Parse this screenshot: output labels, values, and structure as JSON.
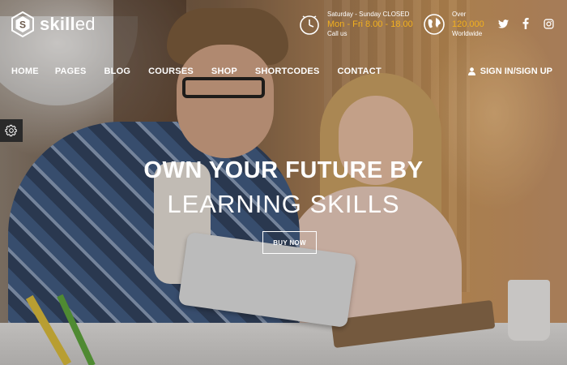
{
  "brand": {
    "name_bold": "skill",
    "name_light": "ed",
    "logo_letter": "S"
  },
  "header": {
    "schedule": {
      "days": "Saturday - Sunday CLOSED",
      "hours": "Mon - Fri 8.00 - 18.00",
      "sub": "Call us"
    },
    "students": {
      "label": "Over",
      "count": "120.000",
      "sub": "Worldwide"
    },
    "social": [
      "twitter-icon",
      "facebook-icon",
      "instagram-icon"
    ]
  },
  "nav": {
    "items": [
      "HOME",
      "PAGES",
      "BLOG",
      "COURSES",
      "SHOP",
      "SHORTCODES",
      "CONTACT"
    ],
    "signin": "SIGN IN/SIGN UP"
  },
  "hero": {
    "title": "OWN YOUR FUTURE BY",
    "subtitle": "LEARNING SKILLS",
    "cta": "BUY NOW"
  },
  "colors": {
    "accent": "#f2b01e",
    "text": "#ffffff",
    "settings_bg": "#2a2a2a"
  }
}
